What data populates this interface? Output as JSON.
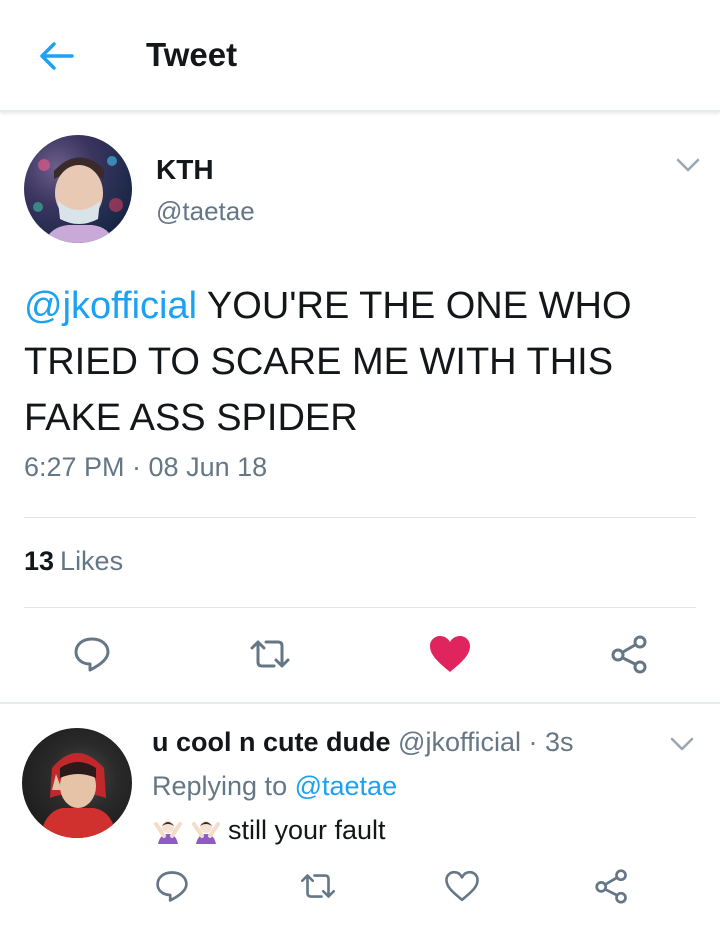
{
  "header": {
    "title": "Tweet",
    "back_icon": "arrow-left-icon",
    "accent": "#1da1f2"
  },
  "tweet": {
    "author_name": "KTH",
    "author_handle": "@taetae",
    "mention": "@jkofficial",
    "text": "YOU'RE THE ONE WHO TRIED TO SCARE ME WITH THIS FAKE ASS SPIDER",
    "timestamp": "6:27 PM · 08 Jun 18",
    "likes_count": "13",
    "likes_label": "Likes",
    "liked": true,
    "like_color": "#e0245e",
    "actions": [
      "reply-icon",
      "retweet-icon",
      "heart-icon",
      "share-icon"
    ]
  },
  "reply": {
    "author_name": "u cool n cute dude",
    "author_handle": "@jkofficial",
    "time": "· 3s",
    "replying_prefix": "Replying to",
    "replying_to": "@taetae",
    "emojis": [
      "person-gesturing-no-emoji",
      "person-gesturing-no-emoji"
    ],
    "text": "still your fault",
    "actions": [
      "reply-icon",
      "retweet-icon",
      "heart-icon",
      "share-icon"
    ]
  }
}
